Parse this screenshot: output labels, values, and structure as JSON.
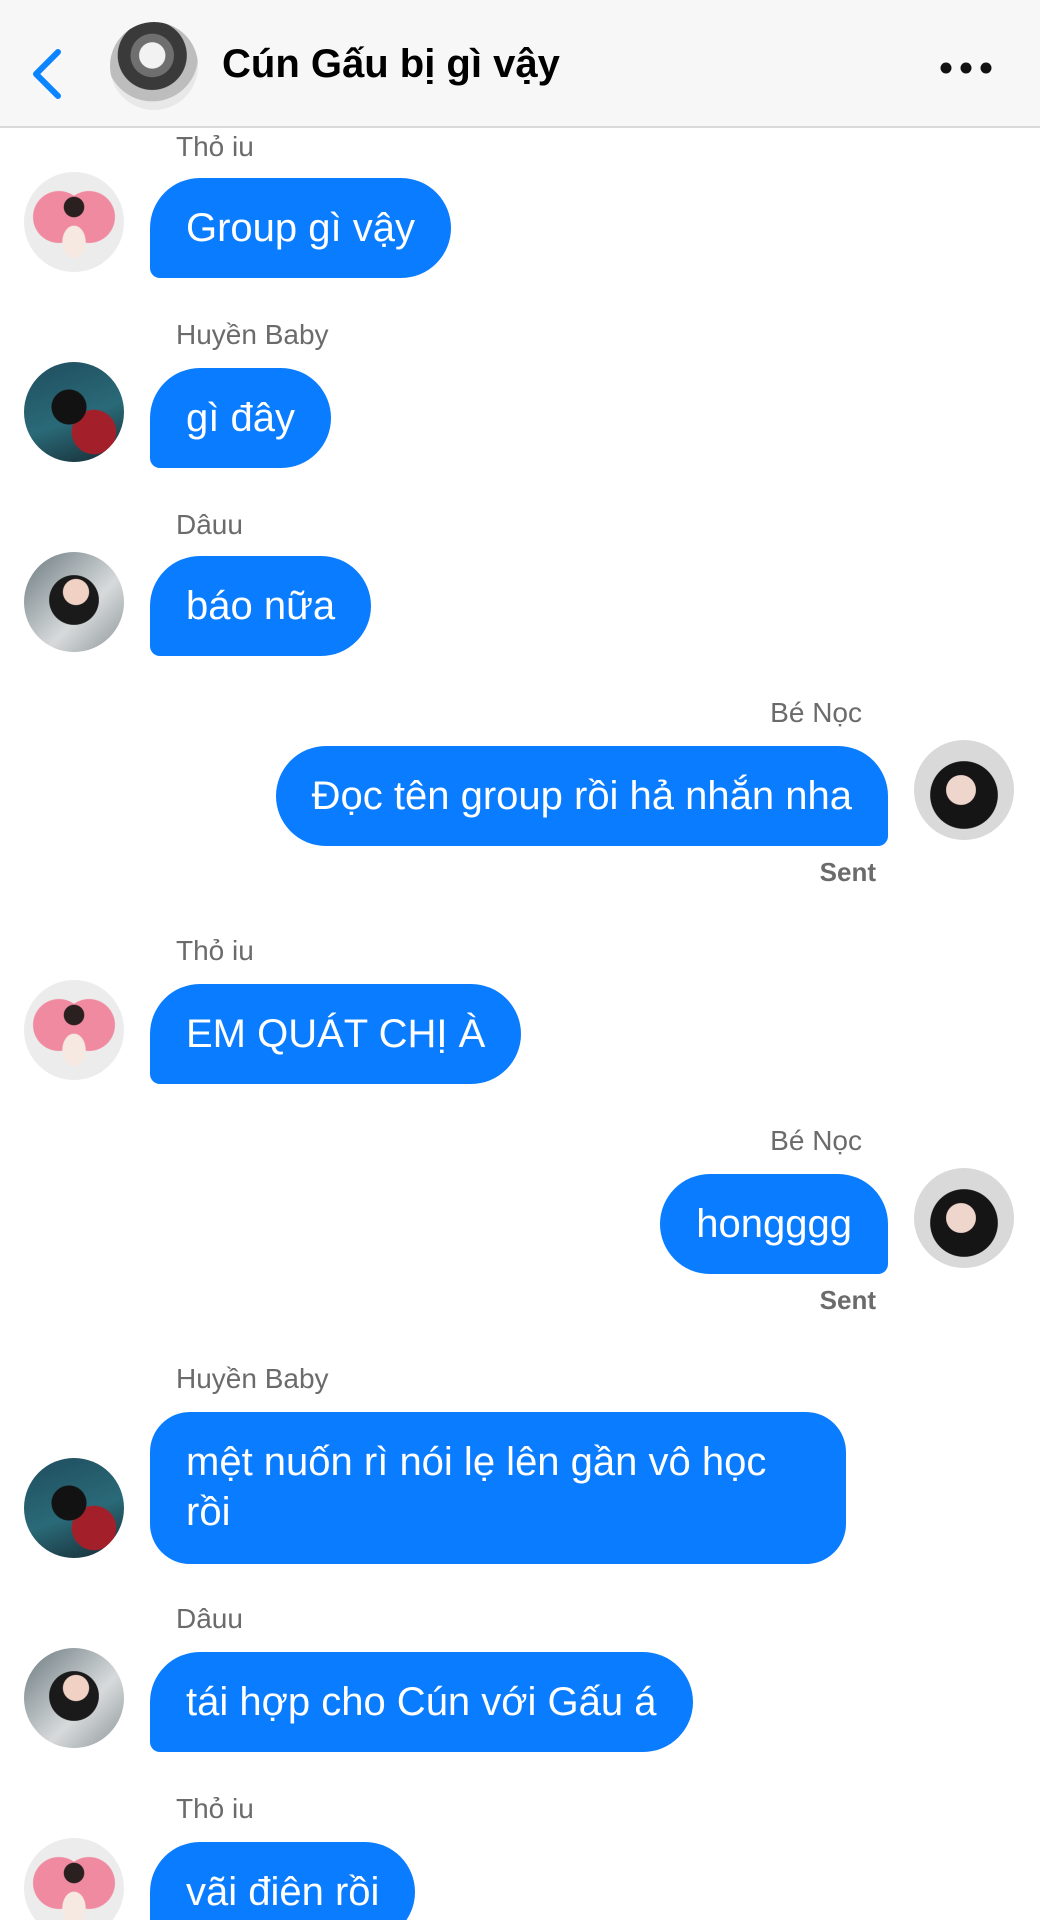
{
  "header": {
    "title": "Cún Gấu bị gì vậy"
  },
  "colors": {
    "bubble": "#0a7cff",
    "header_bg": "#f7f7f8",
    "accent": "#0a84ff"
  },
  "messages": [
    {
      "sender": "Thỏ iu",
      "text": "Group gì vậy"
    },
    {
      "sender": "Huyền Baby",
      "text": "gì đây"
    },
    {
      "sender": "Dâuu",
      "text": "báo nữa"
    },
    {
      "sender": "Bé Nọc",
      "text": "Đọc tên group rồi hả nhắn nha",
      "status": "Sent"
    },
    {
      "sender": "Thỏ iu",
      "text": "EM QUÁT CHỊ À"
    },
    {
      "sender": "Bé Nọc",
      "text": "hongggg",
      "status": "Sent"
    },
    {
      "sender": "Huyền Baby",
      "text": "mệt nuốn rì nói lẹ lên gần vô học rồi"
    },
    {
      "sender": "Dâuu",
      "text": "tái hợp cho Cún với Gấu á"
    },
    {
      "sender": "Thỏ iu",
      "text": "vãi điên rồi"
    }
  ]
}
